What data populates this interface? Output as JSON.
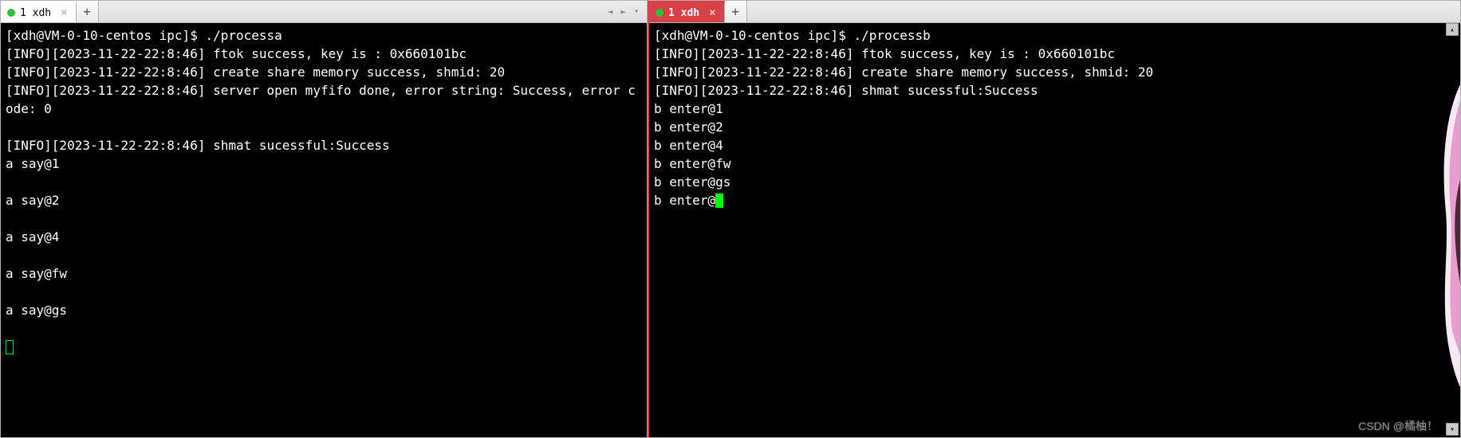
{
  "left": {
    "tab_label": "1 xdh",
    "tab_close": "×",
    "newtab": "+",
    "nav_left": "◄",
    "nav_right": "►",
    "nav_down": "▾",
    "prompt": "[xdh@VM-0-10-centos ipc]$ ./processa",
    "lines": [
      "[INFO][2023-11-22-22:8:46] ftok success, key is : 0x660101bc",
      "[INFO][2023-11-22-22:8:46] create share memory success, shmid: 20",
      "[INFO][2023-11-22-22:8:46] server open myfifo done, error string: Success, error code: 0",
      "",
      "[INFO][2023-11-22-22:8:46] shmat sucessful:Success",
      "a say@1",
      "",
      "a say@2",
      "",
      "a say@4",
      "",
      "a say@fw",
      "",
      "a say@gs",
      ""
    ]
  },
  "right": {
    "tab_label": "1 xdh",
    "tab_close": "×",
    "newtab": "+",
    "scroll_up": "▴",
    "scroll_down": "▾",
    "prompt": "[xdh@VM-0-10-centos ipc]$ ./processb",
    "lines": [
      "[INFO][2023-11-22-22:8:46] ftok success, key is : 0x660101bc",
      "[INFO][2023-11-22-22:8:46] create share memory success, shmid: 20",
      "[INFO][2023-11-22-22:8:46] shmat sucessful:Success",
      "b enter@1",
      "b enter@2",
      "b enter@4",
      "b enter@fw",
      "b enter@gs"
    ],
    "input_line": "b enter@"
  },
  "watermark": "CSDN @橘柚！"
}
